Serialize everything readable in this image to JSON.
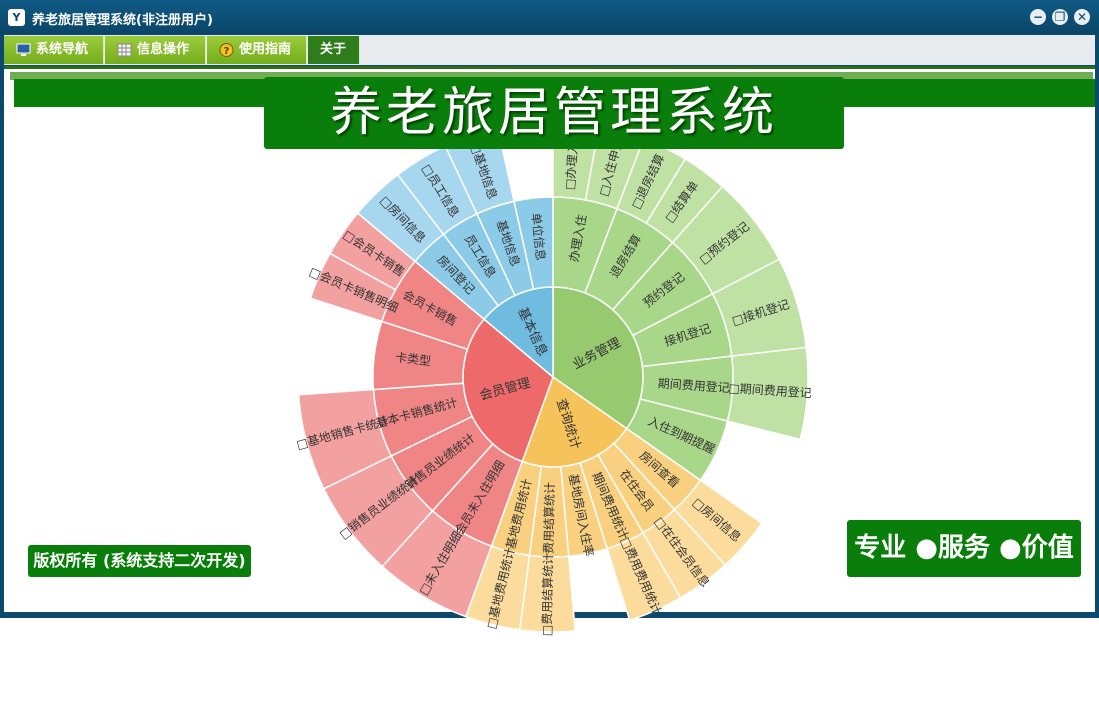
{
  "window": {
    "title": "养老旅居管理系统(非注册用户)",
    "app_icon": "Y",
    "minimize_icon": "−",
    "restore_icon": "❐",
    "close_icon": "✕"
  },
  "menu": [
    {
      "label": "系统导航",
      "icon": "monitor-icon"
    },
    {
      "label": "信息操作",
      "icon": "grid-icon"
    },
    {
      "label": "使用指南",
      "icon": "help-icon"
    },
    {
      "label": "关于",
      "icon": ""
    }
  ],
  "banner": {
    "title": "养老旅居管理系统"
  },
  "copyright": {
    "text": "版权所有 (系统支持二次开发)"
  },
  "slogan": {
    "text": "专业 ●服务 ●价值"
  },
  "colors": {
    "business": "#97c96f",
    "business_mid": "#a9d78a",
    "business_outer": "#bfe2a4",
    "query": "#f6c35a",
    "query_mid": "#f8d07f",
    "query_outer": "#fbdc9c",
    "member": "#ee6a6a",
    "member_mid": "#f08585",
    "member_outer": "#f3a0a0",
    "basic": "#6fbce0",
    "basic_mid": "#8ccbe8",
    "basic_outer": "#a7d7ee"
  },
  "chart_data": {
    "type": "sunburst",
    "sectors": [
      {
        "name": "业务管理",
        "children": [
          {
            "name": "办理入住",
            "leaves": [
              "□办理入住",
              "□入住申请"
            ]
          },
          {
            "name": "退房结算",
            "leaves": [
              "□退房结算",
              "□结算单"
            ]
          },
          {
            "name": "预约登记",
            "leaves": [
              "□预约登记"
            ]
          },
          {
            "name": "接机登记",
            "leaves": [
              "□接机登记"
            ]
          },
          {
            "name": "期间费用登记",
            "leaves": [
              "□期间费用登记"
            ]
          },
          {
            "name": "入住到期提醒",
            "leaves": []
          }
        ]
      },
      {
        "name": "查询统计",
        "children": [
          {
            "name": "房间查看",
            "leaves": [
              "□房间信息"
            ]
          },
          {
            "name": "在住会员",
            "leaves": [
              "□在住会员信息"
            ]
          },
          {
            "name": "期间费用统计",
            "leaves": [
              "□费用费用统计"
            ]
          },
          {
            "name": "基地房间入住率",
            "leaves": []
          },
          {
            "name": "费用结算统计",
            "leaves": [
              "□费用结算统计"
            ]
          },
          {
            "name": "基地费用统计",
            "leaves": [
              "□基地费用统计"
            ]
          }
        ]
      },
      {
        "name": "会员管理",
        "children": [
          {
            "name": "会员未入住明细",
            "leaves": [
              "□未入住明细"
            ]
          },
          {
            "name": "销售员业绩统计",
            "leaves": [
              "□销售员业绩统计"
            ]
          },
          {
            "name": "基本卡销售统计",
            "leaves": [
              "□基地销售卡统计"
            ]
          },
          {
            "name": "卡类型",
            "leaves": []
          },
          {
            "name": "会员卡销售",
            "leaves": [
              "□会员卡销售明细",
              "□会员卡销售"
            ]
          }
        ]
      },
      {
        "name": "基本信息",
        "children": [
          {
            "name": "房间登记",
            "leaves": [
              "□房间信息"
            ]
          },
          {
            "name": "员工信息",
            "leaves": [
              "□员工信息"
            ]
          },
          {
            "name": "基地信息",
            "leaves": [
              "□基地信息"
            ]
          },
          {
            "name": "单位信息",
            "leaves": []
          }
        ]
      }
    ]
  }
}
